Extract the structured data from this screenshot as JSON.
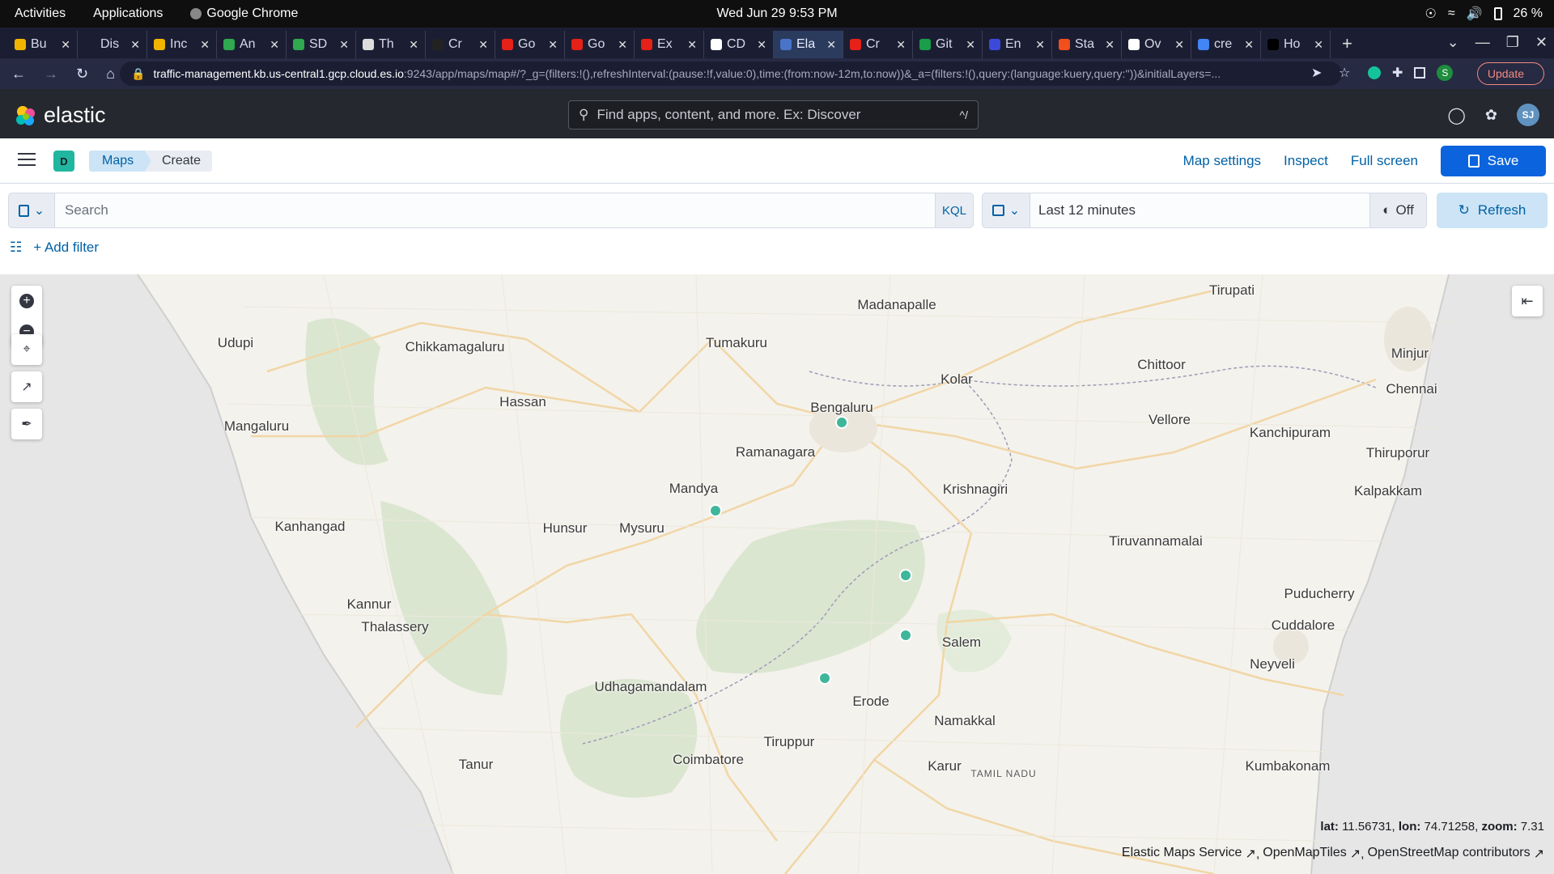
{
  "os": {
    "activities": "Activities",
    "applications": "Applications",
    "active_app": "Google Chrome",
    "datetime": "Wed Jun 29   9:53 PM",
    "battery": "26 %"
  },
  "browser": {
    "tabs": [
      {
        "title": "Bu",
        "color": "#f0b400"
      },
      {
        "title": "Dis",
        "color": "#1b1e33"
      },
      {
        "title": "Inc",
        "color": "#f0b400"
      },
      {
        "title": "An",
        "color": "#2fa84f"
      },
      {
        "title": "SD",
        "color": "#2fa84f"
      },
      {
        "title": "Th",
        "color": "#dddddd"
      },
      {
        "title": "Cr",
        "color": "#222222"
      },
      {
        "title": "Go",
        "color": "#e62117"
      },
      {
        "title": "Go",
        "color": "#e62117"
      },
      {
        "title": "Ex",
        "color": "#e62117"
      },
      {
        "title": "CD",
        "color": "#ffffff"
      },
      {
        "title": "Ela",
        "color": "#4a74c9",
        "active": true
      },
      {
        "title": "Cr",
        "color": "#e62117"
      },
      {
        "title": "Git",
        "color": "#1a9e4a"
      },
      {
        "title": "En",
        "color": "#3b4ad8"
      },
      {
        "title": "Sta",
        "color": "#f24e1e"
      },
      {
        "title": "Ov",
        "color": "#ffffff"
      },
      {
        "title": "cre",
        "color": "#4285f4"
      },
      {
        "title": "Ho",
        "color": "#000000"
      }
    ],
    "url_host": "traffic-management.kb.us-central1.gcp.cloud.es.io",
    "url_path": ":9243/app/maps/map#/?_g=(filters:!(),refreshInterval:(pause:!f,value:0),time:(from:now-12m,to:now))&_a=(filters:!(),query:(language:kuery,query:''))&initialLayers=...",
    "update_label": "Update",
    "profile_initial": "S"
  },
  "kibana": {
    "logo_text": "elastic",
    "search_placeholder": "Find apps, content, and more. Ex: Discover",
    "search_shortcut": "^/",
    "avatar": "SJ",
    "space_initial": "D",
    "breadcrumbs": [
      "Maps",
      "Create"
    ],
    "top_links": [
      "Map settings",
      "Inspect",
      "Full screen"
    ],
    "save_label": "Save",
    "query_placeholder": "Search",
    "kql_label": "KQL",
    "date_range": "Last 12 minutes",
    "auto_refresh": "Off",
    "refresh_label": "Refresh",
    "add_filter": "+ Add filter"
  },
  "map": {
    "colors": {
      "land": "#f4f2ec",
      "sea": "#e6e6e6",
      "forest": "#dbe6d1",
      "point": "#3eb69a",
      "road": "#f3d9ae"
    },
    "cities": [
      "Tirupati",
      "Madanapalle",
      "Udupi",
      "Chikkamagaluru",
      "Tumakuru",
      "Minjur",
      "Chittoor",
      "Kolar",
      "Chennai",
      "Hassan",
      "Bengaluru",
      "Vellore",
      "Mangaluru",
      "Kanchipuram",
      "Thiruporur",
      "Ramanagara",
      "Mandya",
      "Krishnagiri",
      "Kalpakkam",
      "Kanhangad",
      "Hunsur",
      "Mysuru",
      "Tiruvannamalai",
      "Puducherry",
      "Kannur",
      "Thalassery",
      "Cuddalore",
      "Salem",
      "Neyveli",
      "Udhagamandalam",
      "Erode",
      "Namakkal",
      "Tiruppur",
      "Coimbatore",
      "Tanur",
      "Karur",
      "Kumbakonam",
      "TAMIL NADU"
    ],
    "coords_lat_label": "lat:",
    "coords_lat": "11.56731,",
    "coords_lon_label": "lon:",
    "coords_lon": "74.71258,",
    "coords_zoom_label": "zoom:",
    "coords_zoom": "7.31",
    "attribution": [
      "Elastic Maps Service",
      "OpenMapTiles",
      "OpenStreetMap contributors"
    ]
  }
}
